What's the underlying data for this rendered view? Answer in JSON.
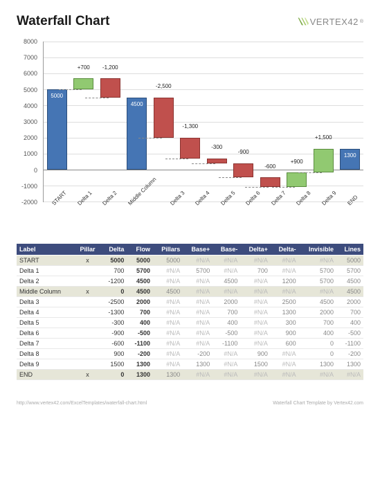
{
  "header": {
    "title": "Waterfall Chart",
    "logo_text": "VERTEX42",
    "logo_tm": "®"
  },
  "chart_data": {
    "type": "bar",
    "ylim": [
      -2000,
      8000
    ],
    "yticks": [
      -2000,
      -1000,
      0,
      1000,
      2000,
      3000,
      4000,
      5000,
      6000,
      7000,
      8000
    ],
    "categories": [
      "START",
      "Delta 1",
      "Delta 2",
      "Middle Column",
      "Delta 3",
      "Delta 4",
      "Delta 5",
      "Delta 6",
      "Delta 7",
      "Delta 8",
      "Delta 9",
      "END"
    ],
    "bars": [
      {
        "name": "START",
        "kind": "pillar",
        "value": 5000,
        "label": "5000",
        "base": 0,
        "top": 5000
      },
      {
        "name": "Delta 1",
        "kind": "pos",
        "value": 700,
        "label": "+700",
        "base": 5000,
        "top": 5700
      },
      {
        "name": "Delta 2",
        "kind": "neg",
        "value": -1200,
        "label": "-1,200",
        "base": 4500,
        "top": 5700
      },
      {
        "name": "Middle Column",
        "kind": "pillar",
        "value": 4500,
        "label": "4500",
        "base": 0,
        "top": 4500
      },
      {
        "name": "Delta 3",
        "kind": "neg",
        "value": -2500,
        "label": "-2,500",
        "base": 2000,
        "top": 4500
      },
      {
        "name": "Delta 4",
        "kind": "neg",
        "value": -1300,
        "label": "-1,300",
        "base": 700,
        "top": 2000
      },
      {
        "name": "Delta 5",
        "kind": "neg",
        "value": -300,
        "label": "-300",
        "base": 400,
        "top": 700
      },
      {
        "name": "Delta 6",
        "kind": "neg",
        "value": -900,
        "label": "-900",
        "base": -500,
        "top": 400
      },
      {
        "name": "Delta 7",
        "kind": "neg",
        "value": -600,
        "label": "-600",
        "base": -1100,
        "top": -500
      },
      {
        "name": "Delta 8",
        "kind": "pos",
        "value": 900,
        "label": "+900",
        "base": -1100,
        "top": -200
      },
      {
        "name": "Delta 9",
        "kind": "pos",
        "value": 1500,
        "label": "+1,500",
        "base": -200,
        "top": 1300
      },
      {
        "name": "END",
        "kind": "pillar",
        "value": 1300,
        "label": "1300",
        "base": 0,
        "top": 1300
      }
    ]
  },
  "table": {
    "headers": [
      "Label",
      "Pillar",
      "Delta",
      "Flow",
      "Pillars",
      "Base+",
      "Base-",
      "Delta+",
      "Delta-",
      "Invisible",
      "Lines"
    ],
    "rows": [
      {
        "label": "START",
        "pillar": "x",
        "delta": "5000",
        "flow": "5000",
        "pillars": "5000",
        "basep": "#N/A",
        "basen": "#N/A",
        "deltap": "#N/A",
        "deltan": "#N/A",
        "inv": "#N/A",
        "lines": "5000",
        "hl": true,
        "bold_delta": true
      },
      {
        "label": "Delta 1",
        "pillar": "",
        "delta": "700",
        "flow": "5700",
        "pillars": "#N/A",
        "basep": "5700",
        "basen": "#N/A",
        "deltap": "700",
        "deltan": "#N/A",
        "inv": "5700",
        "lines": "5700"
      },
      {
        "label": "Delta 2",
        "pillar": "",
        "delta": "-1200",
        "flow": "4500",
        "pillars": "#N/A",
        "basep": "#N/A",
        "basen": "4500",
        "deltap": "#N/A",
        "deltan": "1200",
        "inv": "5700",
        "lines": "4500"
      },
      {
        "label": "Middle Column",
        "pillar": "x",
        "delta": "0",
        "flow": "4500",
        "pillars": "4500",
        "basep": "#N/A",
        "basen": "#N/A",
        "deltap": "#N/A",
        "deltan": "#N/A",
        "inv": "#N/A",
        "lines": "4500",
        "hl": true,
        "bold_delta": true
      },
      {
        "label": "Delta 3",
        "pillar": "",
        "delta": "-2500",
        "flow": "2000",
        "pillars": "#N/A",
        "basep": "#N/A",
        "basen": "2000",
        "deltap": "#N/A",
        "deltan": "2500",
        "inv": "4500",
        "lines": "2000"
      },
      {
        "label": "Delta 4",
        "pillar": "",
        "delta": "-1300",
        "flow": "700",
        "pillars": "#N/A",
        "basep": "#N/A",
        "basen": "700",
        "deltap": "#N/A",
        "deltan": "1300",
        "inv": "2000",
        "lines": "700"
      },
      {
        "label": "Delta 5",
        "pillar": "",
        "delta": "-300",
        "flow": "400",
        "pillars": "#N/A",
        "basep": "#N/A",
        "basen": "400",
        "deltap": "#N/A",
        "deltan": "300",
        "inv": "700",
        "lines": "400"
      },
      {
        "label": "Delta 6",
        "pillar": "",
        "delta": "-900",
        "flow": "-500",
        "pillars": "#N/A",
        "basep": "#N/A",
        "basen": "-500",
        "deltap": "#N/A",
        "deltan": "900",
        "inv": "400",
        "lines": "-500"
      },
      {
        "label": "Delta 7",
        "pillar": "",
        "delta": "-600",
        "flow": "-1100",
        "pillars": "#N/A",
        "basep": "#N/A",
        "basen": "-1100",
        "deltap": "#N/A",
        "deltan": "600",
        "inv": "0",
        "lines": "-1100"
      },
      {
        "label": "Delta 8",
        "pillar": "",
        "delta": "900",
        "flow": "-200",
        "pillars": "#N/A",
        "basep": "-200",
        "basen": "#N/A",
        "deltap": "900",
        "deltan": "#N/A",
        "inv": "0",
        "lines": "-200"
      },
      {
        "label": "Delta 9",
        "pillar": "",
        "delta": "1500",
        "flow": "1300",
        "pillars": "#N/A",
        "basep": "1300",
        "basen": "#N/A",
        "deltap": "1500",
        "deltan": "#N/A",
        "inv": "1300",
        "lines": "1300"
      },
      {
        "label": "END",
        "pillar": "x",
        "delta": "0",
        "flow": "1300",
        "pillars": "1300",
        "basep": "#N/A",
        "basen": "#N/A",
        "deltap": "#N/A",
        "deltan": "#N/A",
        "inv": "#N/A",
        "lines": "#N/A",
        "hl": true,
        "bold_delta": true
      }
    ]
  },
  "footer": {
    "left": "http://www.vertex42.com/ExcelTemplates/waterfall-chart.html",
    "right": "Waterfall Chart Template by Vertex42.com"
  }
}
